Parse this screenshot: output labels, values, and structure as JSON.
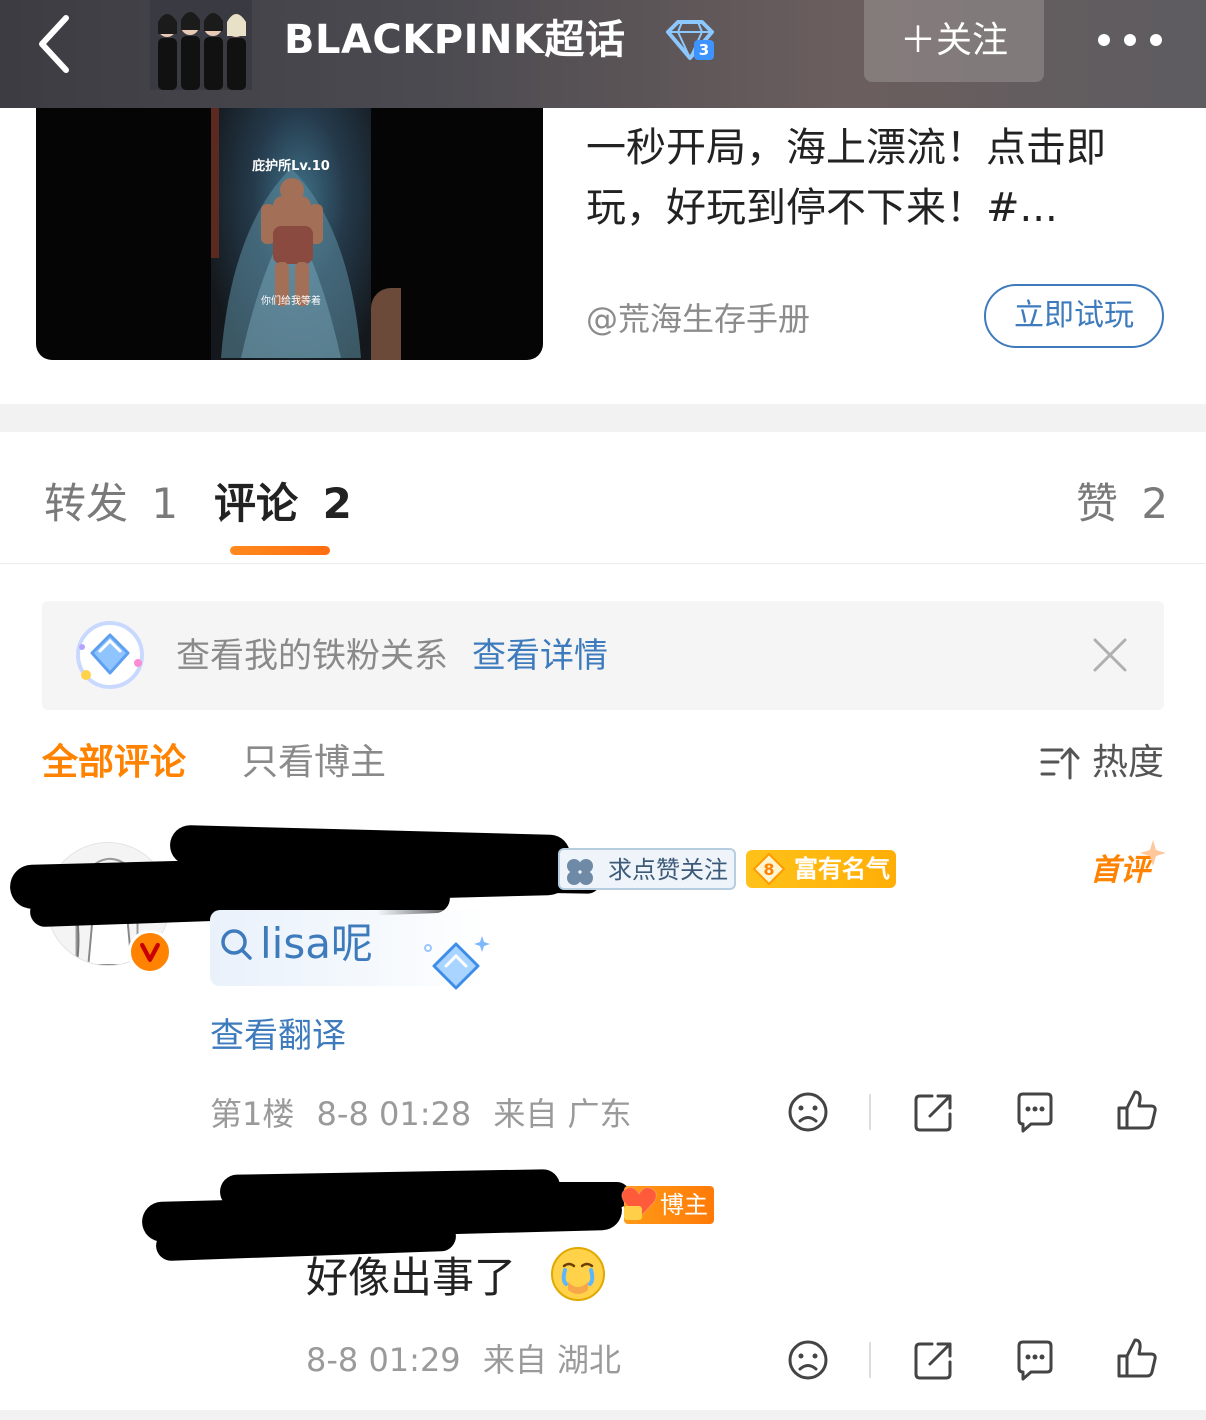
{
  "header": {
    "title": "BLACKPINK超话",
    "follow_label": "＋关注",
    "back_icon": "chevron-left-icon",
    "more_icon": "more-dots-icon",
    "level_badge": "3",
    "bar_color": "#45454b"
  },
  "ad": {
    "title": "一秒开局，海上漂流！点击即玩，好玩到停不下来！#...",
    "source": "@荒海生存手册",
    "cta_label": "立即试玩",
    "video_caption_top": "庇护所Lv.10",
    "video_caption_bottom": "你们给我等着"
  },
  "tabs": [
    {
      "label": "转发",
      "count": "1"
    },
    {
      "label": "评论",
      "count": "2"
    },
    {
      "label": "赞",
      "count": "2"
    }
  ],
  "tab_active_index": 1,
  "fan_banner": {
    "text": "查看我的铁粉关系",
    "link": "查看详情"
  },
  "filters": {
    "all": "全部评论",
    "owner_only": "只看博主",
    "sort": "热度"
  },
  "comments": [
    {
      "badge": "求点赞关注",
      "fame_level": "8",
      "fame_label": "富有名气",
      "first_label": "首评",
      "search_text": "lisa呢",
      "translate_label": "查看翻译",
      "floor": "第1楼",
      "time": "8-8 01:28",
      "location": "来自 广东"
    },
    {
      "owner_tag": "博主",
      "text": "好像出事了",
      "time": "8-8 01:29",
      "location": "来自 湖北"
    }
  ],
  "colors": {
    "accent_orange": "#ff8200",
    "link_blue": "#3e7bbd",
    "muted_text": "#9a9a9a"
  }
}
